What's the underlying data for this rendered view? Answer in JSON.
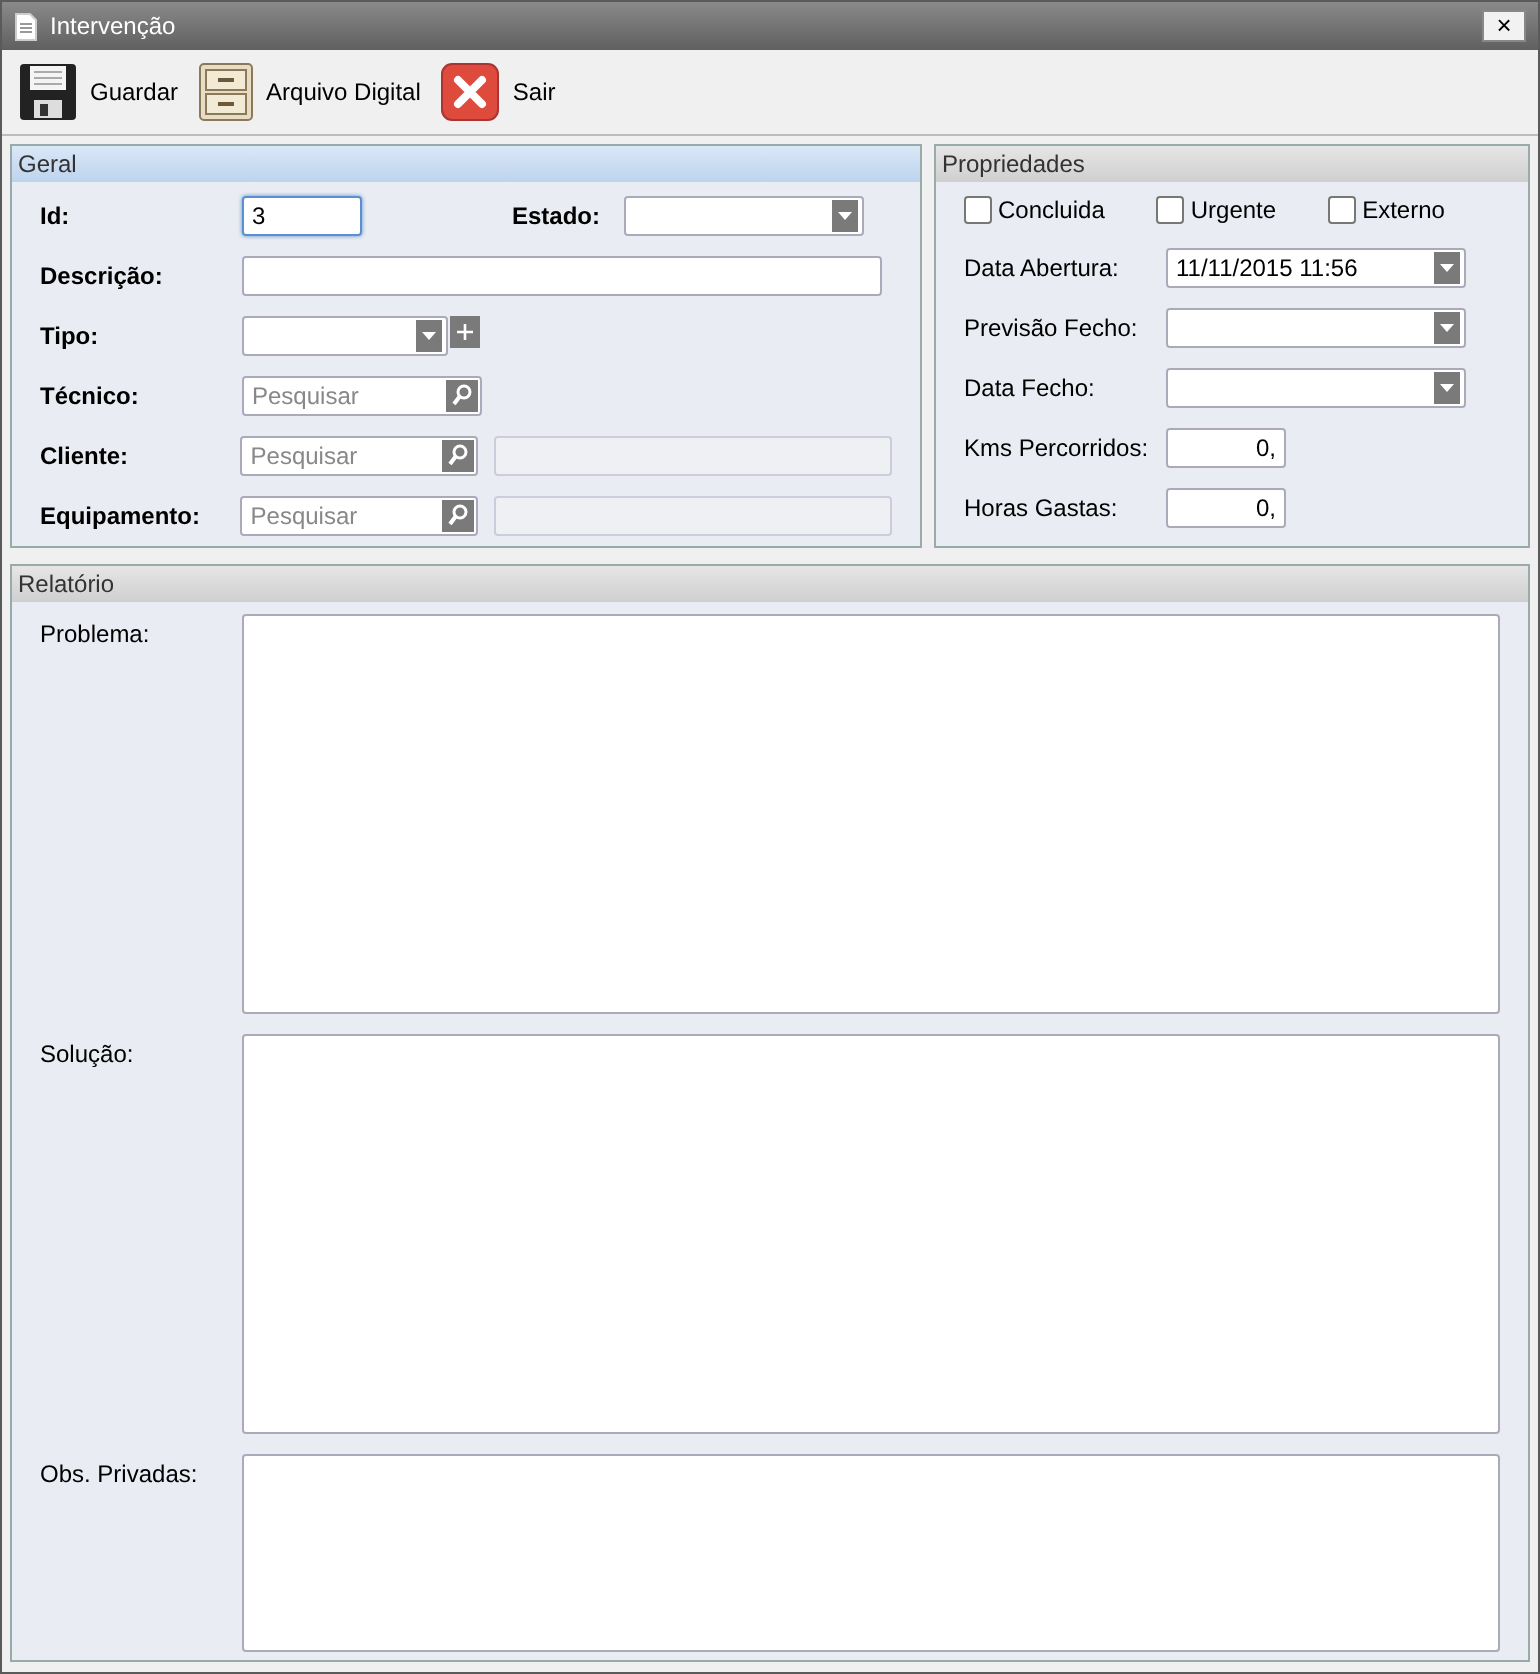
{
  "window": {
    "title": "Intervenção",
    "close": "×"
  },
  "toolbar": [
    {
      "kind": "save",
      "label": "Guardar"
    },
    {
      "kind": "archive",
      "label": "Arquivo Digital"
    },
    {
      "kind": "exit",
      "label": "Sair"
    }
  ],
  "geral": {
    "title": "Geral",
    "rows": [
      {
        "fields": [
          {
            "label": "Id:",
            "kind": "short_text",
            "value": "3",
            "focused": true
          },
          {
            "label": "Estado:",
            "kind": "combo"
          }
        ]
      },
      {
        "fields": [
          {
            "label": "Descrição:",
            "kind": "long_text",
            "focused": false
          }
        ]
      },
      {
        "fields": [
          {
            "label": "Tipo:",
            "kind": "combo_add"
          }
        ]
      },
      {
        "fields": [
          {
            "label": "Técnico:",
            "kind": "search",
            "placeholder": "Pesquisar"
          }
        ]
      },
      {
        "fields": [
          {
            "label": "Cliente:",
            "kind": "search_extra",
            "placeholder": "Pesquisar"
          }
        ]
      },
      {
        "fields": [
          {
            "label": "Equipamento:",
            "kind": "search_extra",
            "placeholder": "Pesquisar"
          }
        ]
      }
    ]
  },
  "propriedades": {
    "title": "Propriedades",
    "checkboxes": [
      {
        "label": "Concluida",
        "checked": false
      },
      {
        "label": "Urgente",
        "checked": false
      },
      {
        "label": "Externo",
        "checked": false
      }
    ],
    "fields": [
      {
        "label": "Data Abertura:",
        "kind": "date",
        "value": "11/11/2015 11:56"
      },
      {
        "label": "Previsão Fecho:",
        "kind": "date"
      },
      {
        "label": "Data Fecho:",
        "kind": "date"
      },
      {
        "label": "Kms Percorridos:",
        "kind": "number",
        "value": "0,"
      },
      {
        "label": "Horas Gastas:",
        "kind": "number",
        "value": "0,"
      }
    ]
  },
  "relatorio": {
    "title": "Relatório",
    "fields": [
      {
        "label": "Problema:"
      },
      {
        "label": "Solução:"
      },
      {
        "label": "Obs. Privadas:"
      }
    ]
  }
}
